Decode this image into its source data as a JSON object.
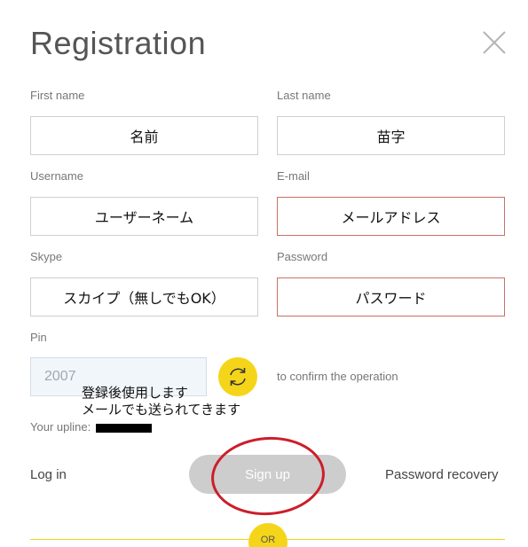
{
  "form": {
    "title": "Registration",
    "first_name": {
      "label": "First name",
      "value": "名前"
    },
    "last_name": {
      "label": "Last name",
      "value": "苗字"
    },
    "username": {
      "label": "Username",
      "value": "ユーザーネーム"
    },
    "email": {
      "label": "E-mail",
      "value": "メールアドレス"
    },
    "skype": {
      "label": "Skype",
      "value": "スカイプ（無しでもOK）"
    },
    "password": {
      "label": "Password",
      "value": "パスワード"
    },
    "pin": {
      "label": "Pin",
      "value": "2007",
      "confirm_text": "to confirm the operation"
    },
    "upline_label": "Your upline:",
    "login_label": "Log in",
    "signup_label": "Sign up",
    "recovery_label": "Password recovery",
    "or_label": "OR"
  },
  "annotation": {
    "line1": "登録後使用します",
    "line2": "メールでも送られてきます"
  },
  "icons": {
    "close": "close-icon",
    "refresh": "refresh-icon"
  },
  "colors": {
    "accent": "#f5d51a",
    "error_border": "#c9706a",
    "annotation_red": "#cc1e2a",
    "button_disabled": "#cdcdcd"
  }
}
